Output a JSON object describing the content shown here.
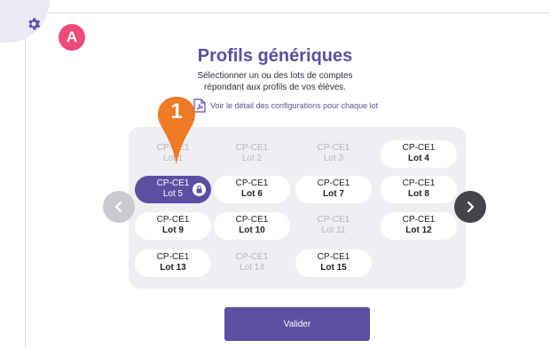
{
  "avatar": {
    "letter": "A"
  },
  "header": {
    "title": "Profils génériques",
    "subtitle_line1": "Sélectionner un ou des lots de comptes",
    "subtitle_line2": "répondant aux profils de vos élèves.",
    "detail_link": "Voir le détail des configurations pour chaque lot"
  },
  "marker": {
    "number": "1"
  },
  "lots": [
    {
      "level": "CP-CE1",
      "name": "Lot 1",
      "state": "disabled"
    },
    {
      "level": "CP-CE1",
      "name": "Lot 2",
      "state": "disabled"
    },
    {
      "level": "CP-CE1",
      "name": "Lot 3",
      "state": "disabled"
    },
    {
      "level": "CP-CE1",
      "name": "Lot 4",
      "state": "available"
    },
    {
      "level": "CP-CE1",
      "name": "Lot 5",
      "state": "selected"
    },
    {
      "level": "CP-CE1",
      "name": "Lot 6",
      "state": "available"
    },
    {
      "level": "CP-CE1",
      "name": "Lot 7",
      "state": "available"
    },
    {
      "level": "CP-CE1",
      "name": "Lot 8",
      "state": "available"
    },
    {
      "level": "CP-CE1",
      "name": "Lot 9",
      "state": "available"
    },
    {
      "level": "CP-CE1",
      "name": "Lot 10",
      "state": "available"
    },
    {
      "level": "CP-CE1",
      "name": "Lot 11",
      "state": "disabled"
    },
    {
      "level": "CP-CE1",
      "name": "Lot 12",
      "state": "available"
    },
    {
      "level": "CP-CE1",
      "name": "Lot 13",
      "state": "available"
    },
    {
      "level": "CP-CE1",
      "name": "Lot 14",
      "state": "disabled"
    },
    {
      "level": "CP-CE1",
      "name": "Lot 15",
      "state": "available"
    }
  ],
  "footer": {
    "validate_label": "Valider"
  },
  "colors": {
    "accent": "#5b4fa3",
    "avatar": "#ec4b78",
    "marker": "#f07a26",
    "panel": "#efeef3"
  },
  "icons": {
    "settings": "gear-icon",
    "prev": "chevron-left-icon",
    "next": "chevron-right-icon",
    "lock": "lock-icon",
    "pdf": "pdf-icon"
  }
}
